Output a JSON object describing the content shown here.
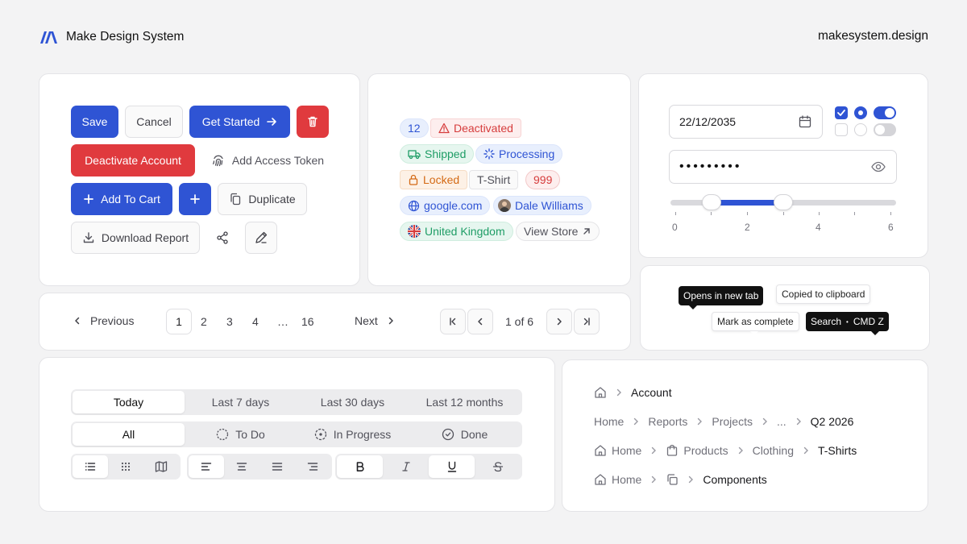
{
  "header": {
    "brand": "Make Design System",
    "site": "makesystem.design"
  },
  "buttons": {
    "save": "Save",
    "cancel": "Cancel",
    "get_started": "Get Started",
    "deactivate": "Deactivate Account",
    "add_token": "Add Access Token",
    "add_to_cart": "Add To Cart",
    "duplicate": "Duplicate",
    "download": "Download Report"
  },
  "badges": {
    "count": "12",
    "deactivated": "Deactivated",
    "shipped": "Shipped",
    "processing": "Processing",
    "locked": "Locked",
    "tshirt": "T-Shirt",
    "num": "999",
    "google": "google.com",
    "user": "Dale Williams",
    "country": "United Kingdom",
    "store": "View Store"
  },
  "form": {
    "date": "22/12/2035",
    "password": "•••••••••",
    "slider_ticks": [
      "0",
      "2",
      "4",
      "6"
    ],
    "slider_range": [
      1,
      3
    ],
    "slider_max": 6
  },
  "tooltips": {
    "new_tab": "Opens in new tab",
    "copied": "Copied to clipboard",
    "complete": "Mark as complete",
    "search": "Search",
    "shortcut": "CMD Z"
  },
  "pagination": {
    "previous": "Previous",
    "next": "Next",
    "pages": [
      "1",
      "2",
      "3",
      "4",
      "…",
      "16"
    ],
    "current": "1",
    "summary": "1 of 6"
  },
  "segments": {
    "ranges": [
      "Today",
      "Last 7 days",
      "Last 30 days",
      "Last 12 months"
    ],
    "status": [
      "All",
      "To Do",
      "In Progress",
      "Done"
    ]
  },
  "breadcrumbs": {
    "b1": {
      "current": "Account"
    },
    "b2": {
      "items": [
        "Home",
        "Reports",
        "Projects",
        "..."
      ],
      "current": "Q2 2026"
    },
    "b3": {
      "items": [
        "Home",
        "Products",
        "Clothing"
      ],
      "current": "T-Shirts"
    },
    "b4": {
      "items": [
        "Home"
      ],
      "current": "Components"
    }
  },
  "colors": {
    "primary": "#2f54d4",
    "danger": "#e03a3e",
    "success": "#1f9d66",
    "warning": "#d46a15"
  }
}
